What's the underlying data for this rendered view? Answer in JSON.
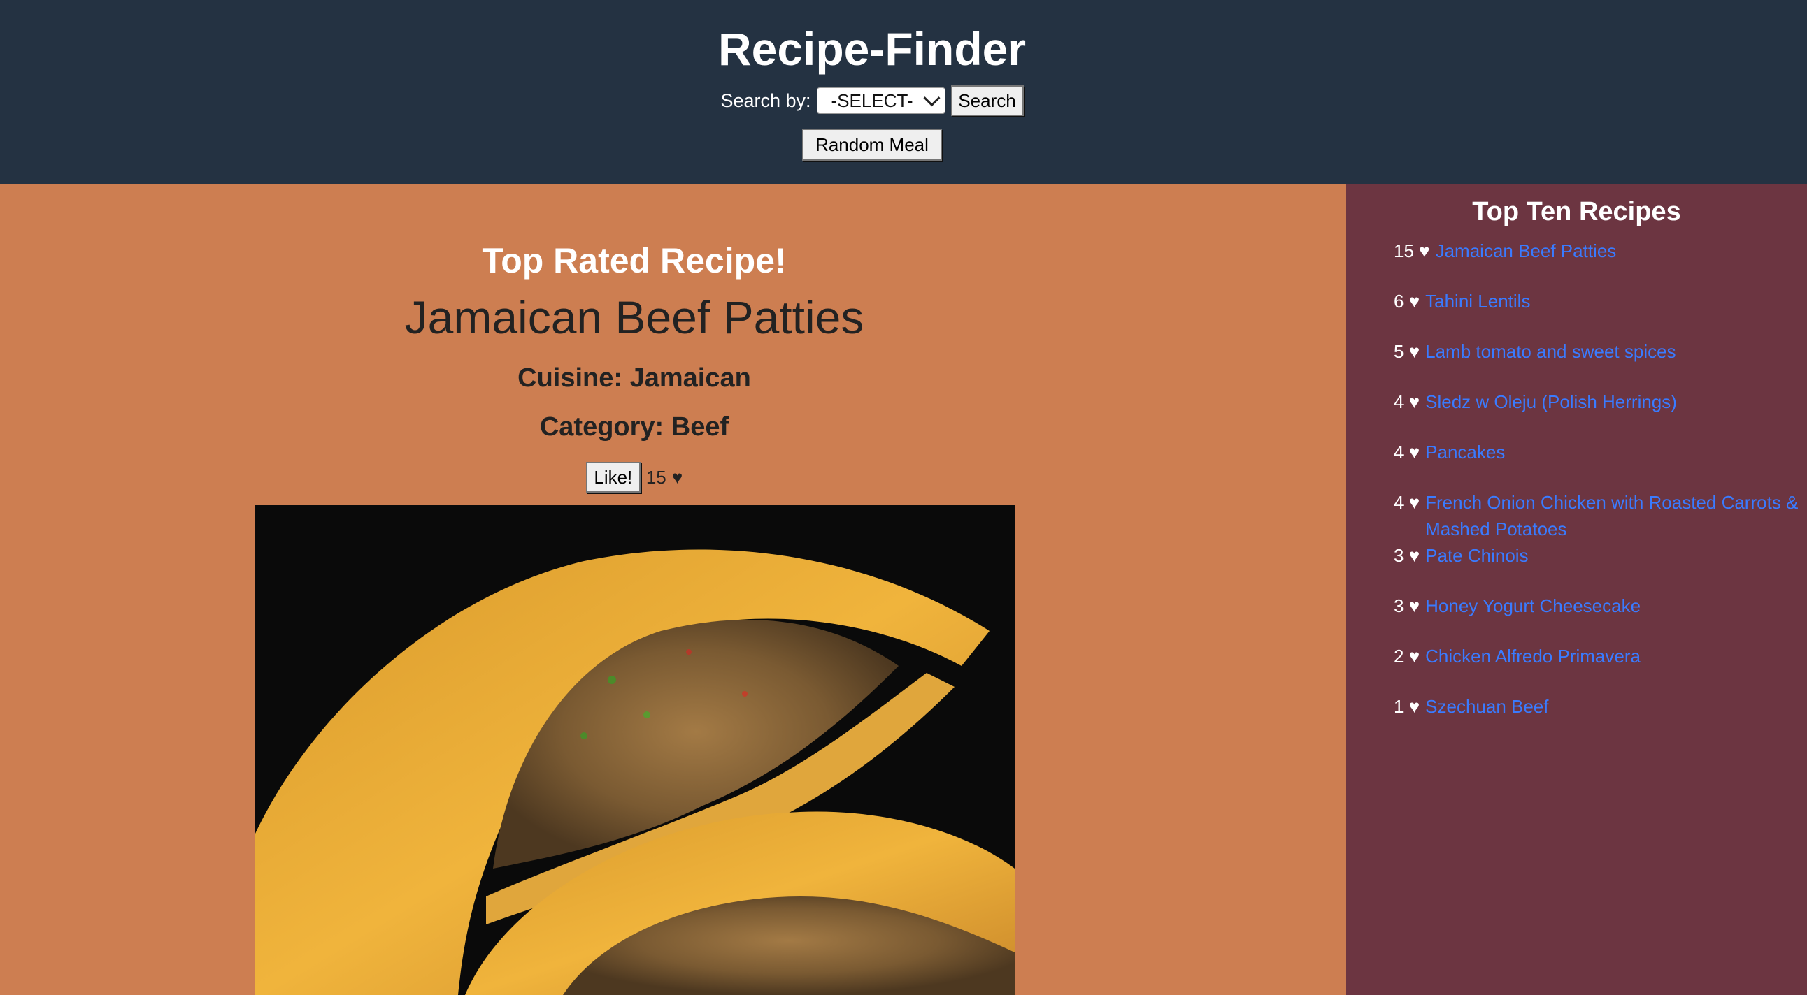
{
  "header": {
    "title": "Recipe-Finder",
    "search_label": "Search by:",
    "select_value": "-SELECT-",
    "search_button": "Search",
    "random_button": "Random Meal"
  },
  "featured": {
    "heading": "Top Rated Recipe!",
    "name": "Jamaican Beef Patties",
    "cuisine": "Cuisine: Jamaican",
    "category": "Category: Beef",
    "like_button": "Like!",
    "likes": "15",
    "heart": "♥",
    "image_icon": "recipe-photo"
  },
  "sidebar": {
    "title": "Top Ten Recipes",
    "heart": "♥",
    "items": [
      {
        "count": "15",
        "name": "Jamaican Beef Patties"
      },
      {
        "count": "6",
        "name": "Tahini Lentils"
      },
      {
        "count": "5",
        "name": "Lamb tomato and sweet spices"
      },
      {
        "count": "4",
        "name": "Sledz w Oleju (Polish Herrings)"
      },
      {
        "count": "4",
        "name": "Pancakes"
      },
      {
        "count": "4",
        "name": "French Onion Chicken with Roasted Carrots & Mashed Potatoes"
      },
      {
        "count": "3",
        "name": "Pate Chinois"
      },
      {
        "count": "3",
        "name": "Honey Yogurt Cheesecake"
      },
      {
        "count": "2",
        "name": "Chicken Alfredo Primavera"
      },
      {
        "count": "1",
        "name": "Szechuan Beef"
      }
    ]
  },
  "colors": {
    "header_bg": "#243242",
    "main_bg": "#cd7e51",
    "sidebar_bg": "#6c3541",
    "link": "#3a7bff"
  }
}
